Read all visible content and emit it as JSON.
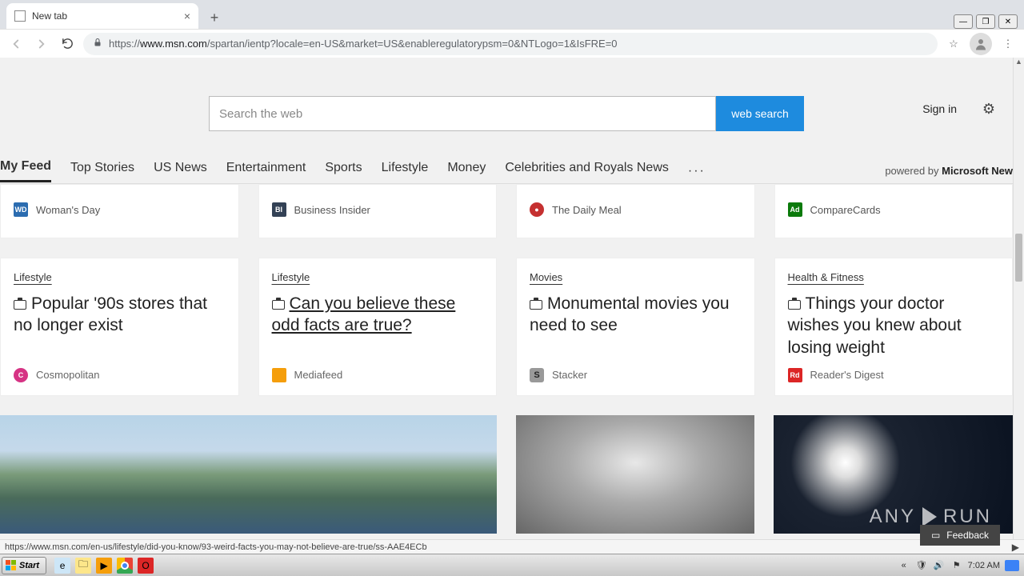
{
  "browser": {
    "tab_title": "New tab",
    "url_proto": "https://",
    "url_host": "www.msn.com",
    "url_path": "/spartan/ientp?locale=en-US&market=US&enableregulatorypsm=0&NTLogo=1&IsFRE=0"
  },
  "header": {
    "search_placeholder": "Search the web",
    "search_button": "web search",
    "signin": "Sign in"
  },
  "nav": {
    "items": [
      "My Feed",
      "Top Stories",
      "US News",
      "Entertainment",
      "Sports",
      "Lifestyle",
      "Money",
      "Celebrities and Royals News"
    ],
    "more": "···",
    "powered_prefix": "powered by ",
    "powered_brand": "Microsoft New"
  },
  "top_sources": [
    {
      "badge": "WD",
      "cls": "badge-wd",
      "name": "Woman's Day"
    },
    {
      "badge": "BI",
      "cls": "badge-bi",
      "name": "Business Insider"
    },
    {
      "badge": "●",
      "cls": "badge-dm",
      "name": "The Daily Meal"
    },
    {
      "badge": "Ad",
      "cls": "badge-ad",
      "name": "CompareCards"
    }
  ],
  "articles": [
    {
      "cat": "Lifestyle",
      "title": "Popular '90s stores that no longer exist",
      "src_badge": "C",
      "src_cls": "badge-cosmo",
      "src": "Cosmopolitan",
      "hovered": false
    },
    {
      "cat": "Lifestyle",
      "title": "Can you believe these odd facts are true?",
      "src_badge": "",
      "src_cls": "badge-mf",
      "src": "Mediafeed",
      "hovered": true
    },
    {
      "cat": "Movies",
      "title": "Monumental movies you need to see",
      "src_badge": "S",
      "src_cls": "badge-stacker",
      "src": "Stacker",
      "hovered": false
    },
    {
      "cat": "Health & Fitness",
      "title": "Things your doctor wishes you knew about losing weight",
      "src_badge": "Rd",
      "src_cls": "badge-rd",
      "src": "Reader's Digest",
      "hovered": false
    }
  ],
  "feedback": "Feedback",
  "status_url": "https://www.msn.com/en-us/lifestyle/did-you-know/93-weird-facts-you-may-not-believe-are-true/ss-AAE4ECb",
  "anyrun": "ANY",
  "anyrun2": "RUN",
  "taskbar": {
    "start": "Start",
    "time": "7:02 AM"
  }
}
